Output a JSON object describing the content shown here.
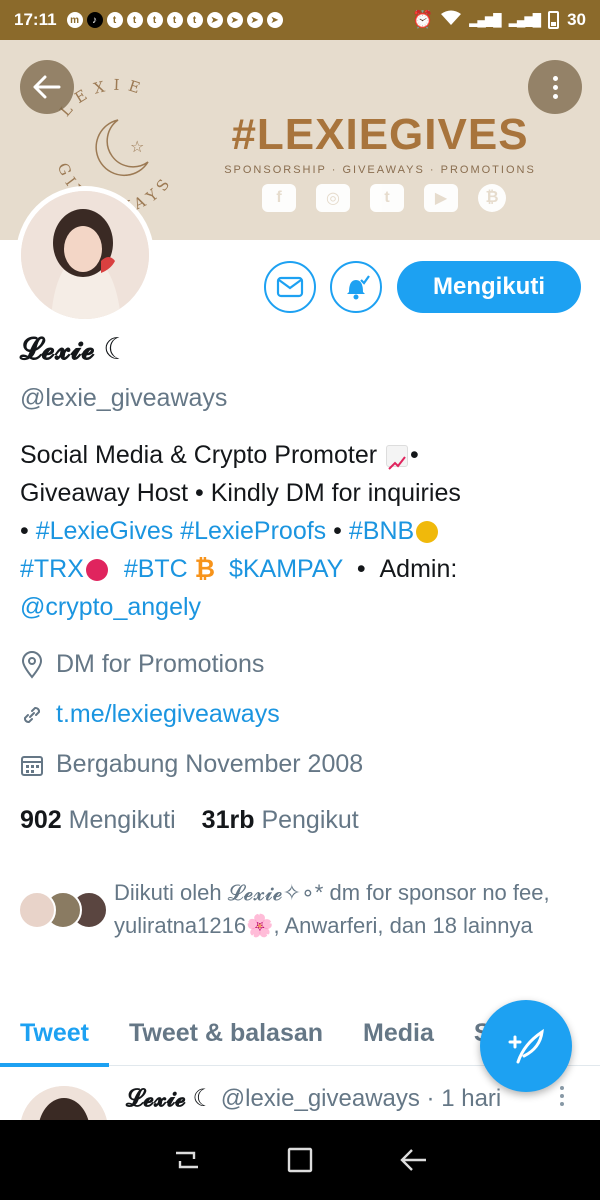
{
  "status_bar": {
    "time": "17:11",
    "battery": "30",
    "notification_icons": [
      "messenger-icon",
      "tiktok-icon",
      "twitter-icon",
      "twitter-icon",
      "twitter-icon",
      "twitter-icon",
      "twitter-icon",
      "telegram-icon",
      "telegram-icon",
      "telegram-icon",
      "telegram-icon"
    ]
  },
  "banner": {
    "hashtag": "#LEXIEGIVES",
    "tagline": "SPONSORSHIP · GIVEAWAYS · PROMOTIONS",
    "logo_text": "LEXIE GIVEAWAYS",
    "social_icons": [
      "f",
      "◎",
      "t",
      "▶",
      "₿"
    ]
  },
  "actions": {
    "follow_label": "Mengikuti"
  },
  "profile": {
    "name": "𝓛𝓮𝔁𝓲𝓮 ☾",
    "handle": "@lexie_giveaways",
    "bio": {
      "line1": "Social Media & Crypto Promoter",
      "line1_end": "•",
      "line2": "Giveaway Host • Kindly DM for inquiries",
      "bullet_a": "•",
      "tag1": "#LexieGives",
      "tag2": "#LexieProofs",
      "bullet_b": "•",
      "tag3": "#BNB",
      "tag4": "#TRX",
      "tag5": "#BTC",
      "tag6": "$KAMPAY",
      "bullet_c": "•",
      "admin_label": "Admin:",
      "admin_handle": "@crypto_angely"
    },
    "location": "DM for Promotions",
    "website": "t.me/lexiegiveaways",
    "joined": "Bergabung November 2008",
    "following_count": "902",
    "following_label": "Mengikuti",
    "followers_count": "31rb",
    "followers_label": "Pengikut",
    "followed_by": "Diikuti oleh 𝓛𝓮𝔁𝓲𝓮✧∘* dm for sponsor no fee, yuliratna1216🌸, Anwarferi, dan 18 lainnya"
  },
  "tabs": [
    "Tweet",
    "Tweet & balasan",
    "Media",
    "Suka"
  ],
  "tweet": {
    "name": "𝓛𝓮𝔁𝓲𝓮 ☾",
    "meta": "@lexie_giveaways · 1 hari"
  },
  "colors": {
    "accent": "#1da1f2",
    "banner": "#e6dccd",
    "status_bar": "#8b6a2b"
  }
}
